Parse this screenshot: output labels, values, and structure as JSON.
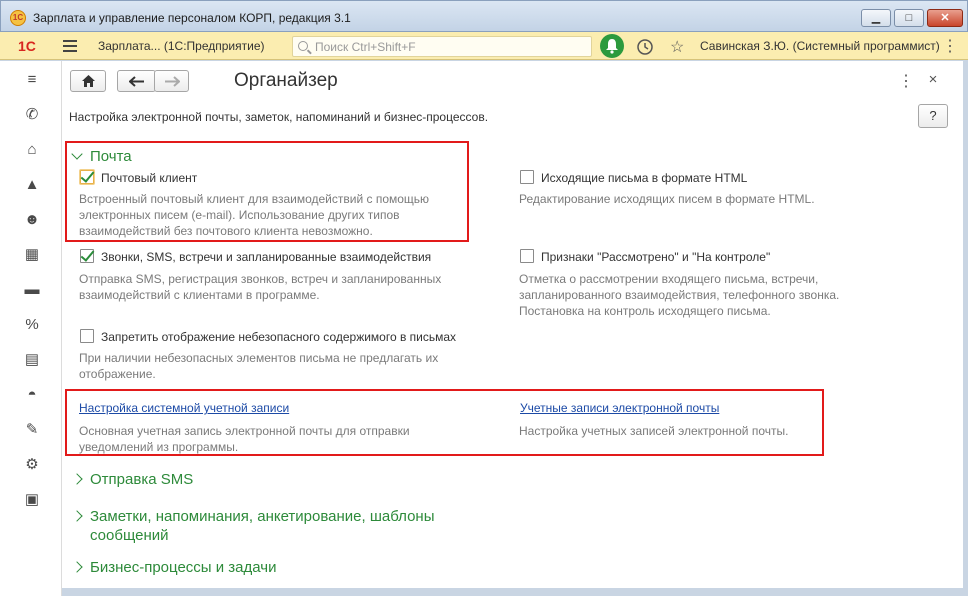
{
  "window": {
    "title": "Зарплата и управление персоналом КОРП, редакция 3.1",
    "minimize": "▁",
    "maximize": "□",
    "close": "✕"
  },
  "toolbar": {
    "logo": "1С",
    "app_name": "Зарплата...  (1С:Предприятие)",
    "search_placeholder": "Поиск Ctrl+Shift+F",
    "user": "Савинская З.Ю. (Системный программист)",
    "more": "⋮"
  },
  "sidebar": {
    "items": [
      {
        "icon": "menu-list-icon",
        "glyph": "≡"
      },
      {
        "icon": "phone-icon",
        "glyph": "✆"
      },
      {
        "icon": "gift-icon",
        "glyph": "⌂"
      },
      {
        "icon": "graduation-cap-icon",
        "glyph": "▲"
      },
      {
        "icon": "people-icon",
        "glyph": "☻"
      },
      {
        "icon": "calculator-icon",
        "glyph": "▦"
      },
      {
        "icon": "card-icon",
        "glyph": "▬"
      },
      {
        "icon": "percent-icon",
        "glyph": "%"
      },
      {
        "icon": "documents-icon",
        "glyph": "▤"
      },
      {
        "icon": "helmet-icon",
        "glyph": "◓"
      },
      {
        "icon": "wrench-icon",
        "glyph": "✎"
      },
      {
        "icon": "gear-icon",
        "glyph": "⚙"
      },
      {
        "icon": "id-card-icon",
        "glyph": "▣"
      }
    ]
  },
  "form": {
    "title": "Органайзер",
    "subtitle": "Настройка электронной почты, заметок, напоминаний и бизнес-процессов.",
    "help": "?",
    "more": "⋮",
    "close": "×"
  },
  "mail": {
    "header": "Почта",
    "mail_client": {
      "label": "Почтовый клиент",
      "checked": true,
      "desc": [
        "Встроенный почтовый клиент для взаимодействий с помощью",
        "электронных писем (e-mail). Использование других типов",
        "взаимодействий без почтового клиента невозможно."
      ]
    },
    "html_letters": {
      "label": "Исходящие письма в формате HTML",
      "checked": false,
      "desc": [
        "Редактирование исходящих писем в формате HTML."
      ]
    },
    "calls": {
      "label": "Звонки, SMS, встречи и запланированные взаимодействия",
      "checked": true,
      "desc": [
        "Отправка SMS, регистрация звонков, встреч и запланированных",
        "взаимодействий с клиентами в программе."
      ]
    },
    "reviewed": {
      "label": "Признаки \"Рассмотрено\" и \"На контроле\"",
      "checked": false,
      "desc": [
        "Отметка о рассмотрении входящего письма, встречи,",
        "запланированного взаимодействия, телефонного звонка.",
        "Постановка на контроль исходящего письма."
      ]
    },
    "unsafe": {
      "label": "Запретить отображение небезопасного содержимого в письмах",
      "checked": false,
      "desc": [
        "При наличии небезопасных элементов письма не предлагать их",
        "отображение."
      ]
    },
    "system_account": {
      "link": "Настройка системной учетной записи",
      "desc": [
        "Основная учетная запись электронной почты для отправки",
        "уведомлений из программы."
      ]
    },
    "email_accounts": {
      "link": "Учетные записи электронной почты",
      "desc": [
        "Настройка учетных записей электронной почты."
      ]
    }
  },
  "groups": {
    "sms": "Отправка SMS",
    "notes_line1": "Заметки, напоминания, анкетирование, шаблоны",
    "notes_line2": "сообщений",
    "bp": "Бизнес-процессы и задачи"
  }
}
